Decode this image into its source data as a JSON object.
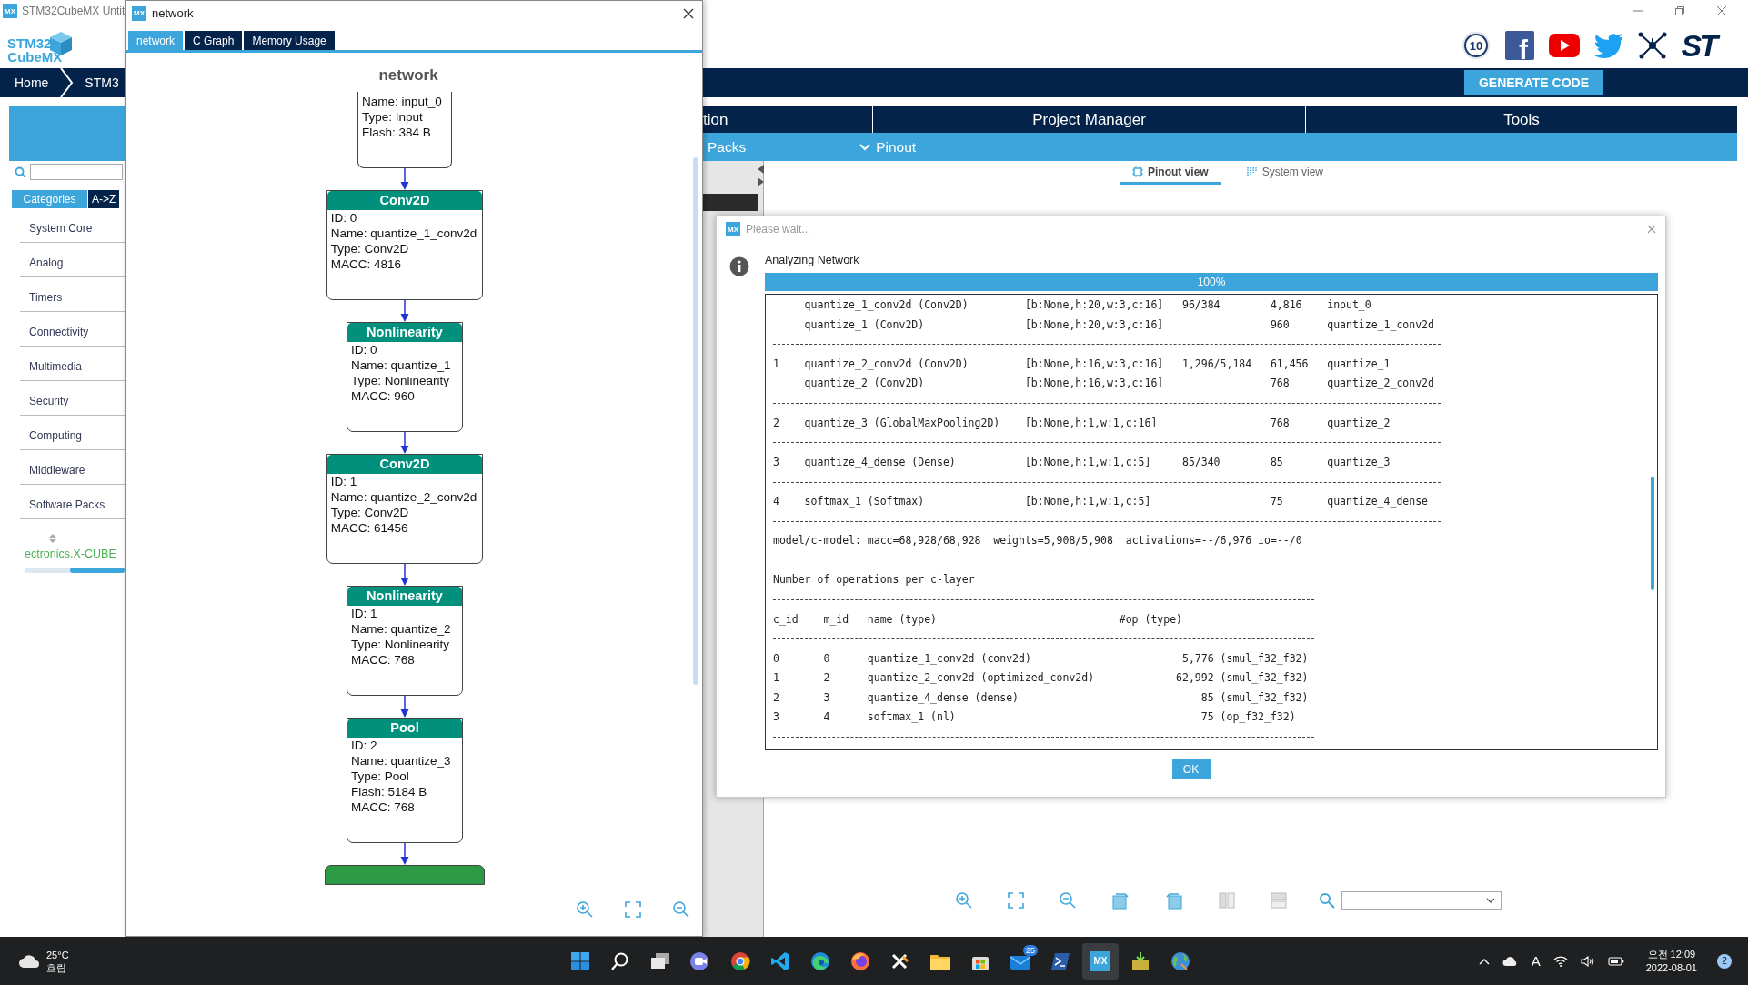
{
  "app_window": {
    "icon": "MX",
    "title": "STM32CubeMX Untit",
    "logo": {
      "top": "STM32",
      "bottom": "CubeMX"
    },
    "anniversary_badge": "10",
    "facebook_glyph": "f",
    "brand_logo": "ST",
    "breadcrumb": [
      "Home",
      "STM3"
    ],
    "generate_button": "GENERATE CODE",
    "main_tabs": [
      "tion",
      "Project Manager",
      "Tools"
    ],
    "sub_tabs": [
      {
        "label": "Packs",
        "kind": "plain"
      },
      {
        "label": "Pinout",
        "kind": "dropdown"
      }
    ],
    "view_tabs": [
      {
        "label": "Pinout view",
        "selected": true
      },
      {
        "label": "System view",
        "selected": false
      }
    ],
    "category_tabs": [
      {
        "label": "Categories",
        "selected": true
      },
      {
        "label": "A->Z",
        "selected": false
      }
    ],
    "categories": [
      "System Core",
      "Analog",
      "Timers",
      "Connectivity",
      "Multimedia",
      "Security",
      "Computing",
      "Middleware",
      "Software Packs"
    ],
    "pack_item": "ectronics.X-CUBE"
  },
  "network_window": {
    "icon": "MX",
    "title": "network",
    "tabs": [
      {
        "label": "network",
        "selected": true
      },
      {
        "label": "C Graph",
        "selected": false
      },
      {
        "label": "Memory Usage",
        "selected": false
      }
    ],
    "heading": "network",
    "nodes": [
      {
        "lines": [
          "Name: input_0",
          "Type: Input",
          "Flash: 384 B"
        ]
      },
      {
        "title": "Conv2D",
        "color": "#00907c",
        "lines": [
          "ID: 0",
          "Name: quantize_1_conv2d",
          "Type: Conv2D",
          "MACC: 4816"
        ]
      },
      {
        "title": "Nonlinearity",
        "color": "#00907c",
        "lines": [
          "ID: 0",
          "Name: quantize_1",
          "Type: Nonlinearity",
          "MACC: 960"
        ]
      },
      {
        "title": "Conv2D",
        "color": "#00907c",
        "lines": [
          "ID: 1",
          "Name: quantize_2_conv2d",
          "Type: Conv2D",
          "MACC: 61456"
        ]
      },
      {
        "title": "Nonlinearity",
        "color": "#00907c",
        "lines": [
          "ID: 1",
          "Name: quantize_2",
          "Type: Nonlinearity",
          "MACC: 768"
        ]
      },
      {
        "title": "Pool",
        "color": "#00907c",
        "lines": [
          "ID: 2",
          "Name: quantize_3",
          "Type: Pool",
          "Flash: 5184 B",
          "MACC: 768"
        ]
      },
      {
        "color": "#2f9a45"
      }
    ]
  },
  "dialog": {
    "icon": "MX",
    "title": "Please wait...",
    "message": "Analyzing Network",
    "progress": {
      "level": 1,
      "reading": "100%"
    },
    "report": {
      "layers": [
        {
          "rows": [
            {
              "name": "quantize_1_conv2d (Conv2D)",
              "shape": "[b:None,h:20,w:3,c:16]",
              "param": "96/384",
              "macc": "4,816",
              "connected": "input_0"
            },
            {
              "name": "quantize_1 (Conv2D)",
              "shape": "[b:None,h:20,w:3,c:16]",
              "macc": "960",
              "connected": "quantize_1_conv2d"
            }
          ]
        },
        {
          "c_id": "1",
          "rows": [
            {
              "name": "quantize_2_conv2d (Conv2D)",
              "shape": "[b:None,h:16,w:3,c:16]",
              "param": "1,296/5,184",
              "macc": "61,456",
              "connected": "quantize_1"
            },
            {
              "name": "quantize_2 (Conv2D)",
              "shape": "[b:None,h:16,w:3,c:16]",
              "macc": "768",
              "connected": "quantize_2_conv2d"
            }
          ]
        },
        {
          "c_id": "2",
          "rows": [
            {
              "name": "quantize_3 (GlobalMaxPooling2D)",
              "shape": "[b:None,h:1,w:1,c:16]",
              "macc": "768",
              "connected": "quantize_2"
            }
          ]
        },
        {
          "c_id": "3",
          "rows": [
            {
              "name": "quantize_4_dense (Dense)",
              "shape": "[b:None,h:1,w:1,c:5]",
              "param": "85/340",
              "macc": "85",
              "connected": "quantize_3"
            }
          ]
        },
        {
          "c_id": "4",
          "rows": [
            {
              "name": "softmax_1 (Softmax)",
              "shape": "[b:None,h:1,w:1,c:5]",
              "macc": "75",
              "connected": "quantize_4_dense"
            }
          ]
        }
      ],
      "summary": "model/c-model: macc=68,928/68,928  weights=5,908/5,908  activations=--/6,976 io=--/0",
      "ops_title": "Number of operations per c-layer",
      "ops_columns": [
        "c_id",
        "m_id",
        "name (type)",
        "#op (type)"
      ],
      "ops": [
        {
          "c_id": "0",
          "m_id": "0",
          "name": "quantize_1_conv2d (conv2d)",
          "op": "5,776",
          "op_type": "(smul_f32_f32)"
        },
        {
          "c_id": "1",
          "m_id": "2",
          "name": "quantize_2_conv2d (optimized_conv2d)",
          "op": "62,992",
          "op_type": "(smul_f32_f32)"
        },
        {
          "c_id": "2",
          "m_id": "3",
          "name": "quantize_4_dense (dense)",
          "op": "85",
          "op_type": "(smul_f32_f32)"
        },
        {
          "c_id": "3",
          "m_id": "4",
          "name": "softmax_1 (nl)",
          "op": "75",
          "op_type": "(op_f32_f32)"
        }
      ]
    },
    "ok_button": "OK"
  },
  "taskbar": {
    "weather": {
      "temperature": "25°C",
      "condition": "흐림"
    },
    "apps": [
      {
        "kind": "start",
        "selected": false
      },
      {
        "kind": "search",
        "selected": false
      },
      {
        "kind": "taskview",
        "selected": false
      },
      {
        "kind": "chat",
        "selected": false
      },
      {
        "kind": "chrome",
        "selected": false
      },
      {
        "kind": "code",
        "selected": false
      },
      {
        "kind": "edge",
        "selected": false
      },
      {
        "kind": "firefox",
        "selected": false
      },
      {
        "kind": "tool",
        "selected": false
      },
      {
        "kind": "folder",
        "selected": false
      },
      {
        "kind": "store",
        "selected": false
      },
      {
        "kind": "mail",
        "badge": "25",
        "selected": false
      },
      {
        "kind": "terminal",
        "selected": false
      },
      {
        "kind": "mx",
        "label": "MX",
        "selected": true
      },
      {
        "kind": "installer",
        "selected": false
      },
      {
        "kind": "globe",
        "selected": false
      }
    ],
    "ime": "A",
    "time": "오전 12:09",
    "date": "2022-08-01",
    "notifications": "2"
  }
}
